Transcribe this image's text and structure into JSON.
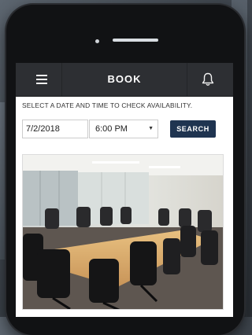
{
  "header": {
    "title": "BOOK"
  },
  "availability": {
    "prompt": "SELECT A DATE AND TIME TO CHECK AVAILABILITY.",
    "date_value": "7/2/2018",
    "time_value": "6:00 PM",
    "search_label": "SEARCH"
  },
  "icons": {
    "menu": "menu-icon",
    "notifications": "bell-icon"
  },
  "colors": {
    "topbar": "#2d2f33",
    "search_button": "#1f3450"
  }
}
